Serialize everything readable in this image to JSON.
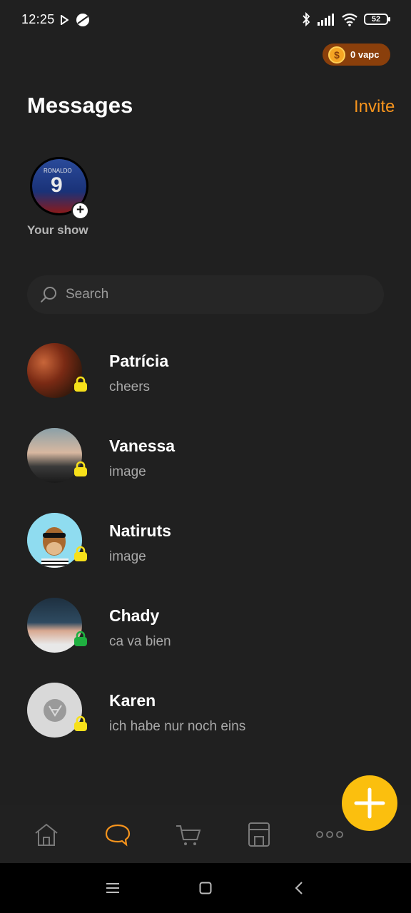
{
  "status": {
    "time": "12:25",
    "battery": "52"
  },
  "coins": {
    "label": "0 vapc"
  },
  "header": {
    "title": "Messages",
    "invite": "Invite"
  },
  "story": {
    "label": "Your show",
    "jersey_name": "RONALDO",
    "jersey_number": "9"
  },
  "search": {
    "placeholder": "Search"
  },
  "conversations": [
    {
      "name": "Patrícia",
      "preview": "cheers",
      "lock_color": "#f7e01a"
    },
    {
      "name": "Vanessa",
      "preview": "image",
      "lock_color": "#f7e01a"
    },
    {
      "name": "Natiruts",
      "preview": "image",
      "lock_color": "#f7e01a"
    },
    {
      "name": "Chady",
      "preview": "ca va bien",
      "lock_color": "#1fb040"
    },
    {
      "name": "Karen",
      "preview": "ich habe nur noch eins",
      "lock_color": "#f7e01a"
    }
  ],
  "tabs": [
    {
      "icon": "home-icon",
      "active": false
    },
    {
      "icon": "chat-icon",
      "active": true
    },
    {
      "icon": "cart-icon",
      "active": false
    },
    {
      "icon": "store-icon",
      "active": false
    },
    {
      "icon": "more-icon",
      "active": false
    }
  ],
  "colors": {
    "accent": "#f7941d",
    "fab": "#fbbf0e",
    "background": "#202020"
  }
}
